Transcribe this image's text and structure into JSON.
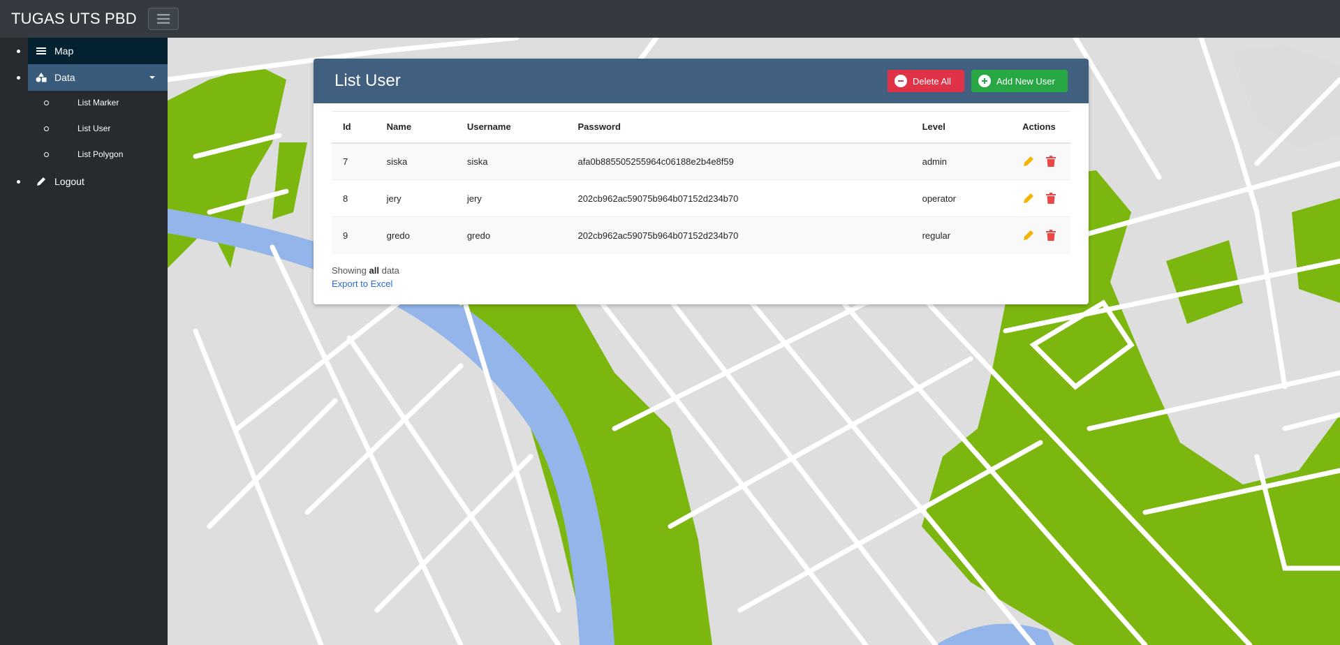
{
  "app": {
    "title": "TUGAS UTS PBD"
  },
  "sidebar": {
    "items": [
      {
        "label": "Map",
        "icon": "menu-lines-icon"
      },
      {
        "label": "Data",
        "icon": "shapes-icon",
        "children": [
          {
            "label": "List Marker"
          },
          {
            "label": "List User"
          },
          {
            "label": "List Polygon"
          }
        ]
      },
      {
        "label": "Logout",
        "icon": "pencil-icon"
      }
    ]
  },
  "card": {
    "title": "List User",
    "delete_all_label": "Delete All",
    "add_new_label": "Add New User"
  },
  "table": {
    "headers": [
      "Id",
      "Name",
      "Username",
      "Password",
      "Level",
      "Actions"
    ],
    "rows": [
      {
        "id": "7",
        "name": "siska",
        "username": "siska",
        "password": "afa0b885505255964c06188e2b4e8f59",
        "level": "admin"
      },
      {
        "id": "8",
        "name": "jery",
        "username": "jery",
        "password": "202cb962ac59075b964b07152d234b70",
        "level": "operator"
      },
      {
        "id": "9",
        "name": "gredo",
        "username": "gredo",
        "password": "202cb962ac59075b964b07152d234b70",
        "level": "regular"
      }
    ]
  },
  "footer": {
    "showing_prefix": "Showing",
    "showing_bold": "all",
    "showing_suffix": "data",
    "export_label": "Export to Excel"
  },
  "colors": {
    "topbar": "#343a40",
    "sidebar": "#272b30",
    "sidebar_active_map": "#04212f",
    "sidebar_active_data": "#395b7b",
    "card_header": "#415f7e",
    "delete_button": "#e03347",
    "add_button": "#28a745",
    "edit_icon": "#f5b400",
    "trash_icon": "#e94848"
  }
}
